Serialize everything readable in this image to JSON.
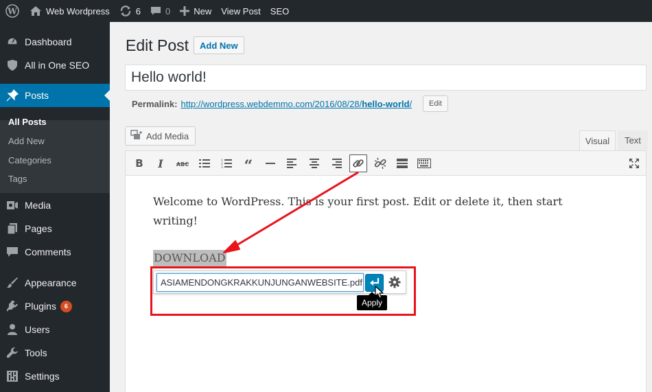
{
  "adminbar": {
    "site_name": "Web Wordpress",
    "updates_count": "6",
    "comments_count": "0",
    "new_label": "New",
    "view_post_label": "View Post",
    "seo_label": "SEO"
  },
  "sidebar": {
    "items": [
      {
        "label": "Dashboard",
        "icon": "dashboard-icon"
      },
      {
        "label": "All in One SEO",
        "icon": "shield-icon"
      },
      {
        "label": "Posts",
        "icon": "pushpin-icon"
      },
      {
        "label": "Media",
        "icon": "media-icon"
      },
      {
        "label": "Pages",
        "icon": "pages-icon"
      },
      {
        "label": "Comments",
        "icon": "comment-icon"
      },
      {
        "label": "Appearance",
        "icon": "brush-icon"
      },
      {
        "label": "Plugins",
        "icon": "plugin-icon",
        "badge": "6"
      },
      {
        "label": "Users",
        "icon": "user-icon"
      },
      {
        "label": "Tools",
        "icon": "wrench-icon"
      },
      {
        "label": "Settings",
        "icon": "settings-icon"
      }
    ],
    "posts_submenu": [
      "All Posts",
      "Add New",
      "Categories",
      "Tags"
    ]
  },
  "header": {
    "title": "Edit Post",
    "add_new_label": "Add New"
  },
  "post": {
    "title": "Hello world!",
    "permalink_label": "Permalink:",
    "permalink_base": "http://wordpress.webdemmo.com/2016/08/28/",
    "permalink_slug": "hello-world",
    "permalink_trail": "/",
    "edit_label": "Edit"
  },
  "editor": {
    "add_media_label": "Add Media",
    "tab_visual": "Visual",
    "tab_text": "Text",
    "content_text": "Welcome to WordPress. This is your first post. Edit or delete it, then start writing!",
    "selected_text": "DOWNLOAD"
  },
  "link_popup": {
    "url_value": "ASIAMENDONGKRAKKUNJUNGANWEBSITE.pdf",
    "apply_tooltip": "Apply"
  },
  "colors": {
    "adminbar": "#23282d",
    "accent": "#0073aa",
    "annotation": "#e8131b",
    "badge": "#d54e21"
  }
}
